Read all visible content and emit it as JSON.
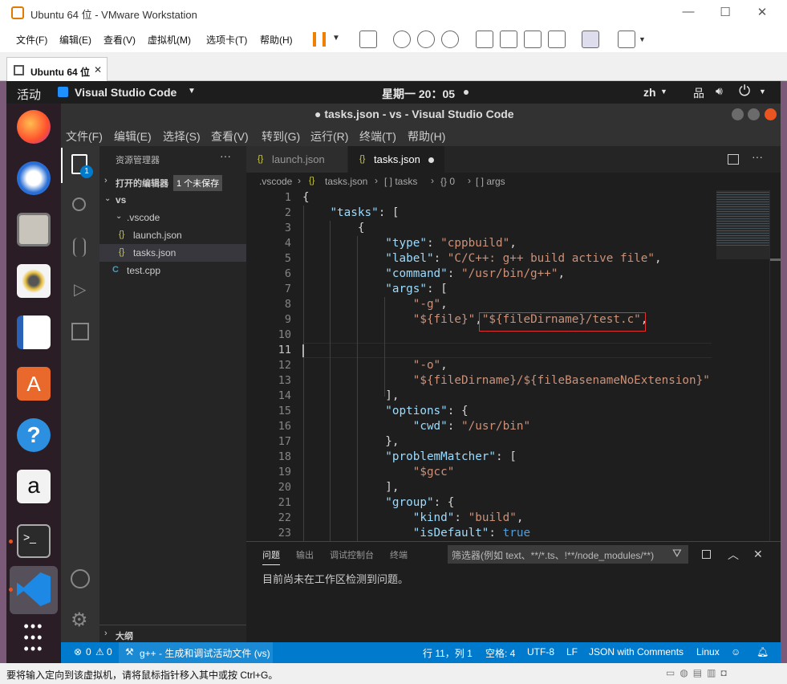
{
  "vmware": {
    "window_title": "Ubuntu 64 位 - VMware Workstation",
    "menus": [
      "文件(F)",
      "编辑(E)",
      "查看(V)",
      "虚拟机(M)",
      "选项卡(T)",
      "帮助(H)"
    ],
    "tab_label": "Ubuntu 64 位",
    "status_hint": "要将输入定向到该虚拟机，请将鼠标指针移入其中或按 Ctrl+G。"
  },
  "gnome": {
    "activities": "活动",
    "app_name": "Visual Studio Code",
    "clock": "星期一 20：05",
    "lang": "zh"
  },
  "vscode": {
    "title": "● tasks.json - vs - Visual Studio Code",
    "menus": [
      "文件(F)",
      "编辑(E)",
      "选择(S)",
      "查看(V)",
      "转到(G)",
      "运行(R)",
      "终端(T)",
      "帮助(H)"
    ],
    "explorer": {
      "header": "资源管理器",
      "open_editors": "打开的编辑器",
      "unsaved_badge": "1 个未保存",
      "folder": "vs",
      "subfolder": ".vscode",
      "files": [
        "launch.json",
        "tasks.json"
      ],
      "root_file": "test.cpp",
      "outline": "大纲"
    },
    "tabs": [
      "launch.json",
      "tasks.json"
    ],
    "breadcrumb": [
      ".vscode",
      "tasks.json",
      "[ ] tasks",
      "{} 0",
      "[ ] args"
    ],
    "source_control_badge": "1",
    "code_lines": [
      [
        {
          "t": "{",
          "c": ""
        }
      ],
      [
        {
          "t": "    ",
          "c": ""
        },
        {
          "t": "\"tasks\"",
          "c": "k"
        },
        {
          "t": ": [",
          "c": ""
        }
      ],
      [
        {
          "t": "        {",
          "c": ""
        }
      ],
      [
        {
          "t": "            ",
          "c": ""
        },
        {
          "t": "\"type\"",
          "c": "k"
        },
        {
          "t": ": ",
          "c": ""
        },
        {
          "t": "\"cppbuild\"",
          "c": "s"
        },
        {
          "t": ",",
          "c": ""
        }
      ],
      [
        {
          "t": "            ",
          "c": ""
        },
        {
          "t": "\"label\"",
          "c": "k"
        },
        {
          "t": ": ",
          "c": ""
        },
        {
          "t": "\"C/C++: g++ build active file\"",
          "c": "s"
        },
        {
          "t": ",",
          "c": ""
        }
      ],
      [
        {
          "t": "            ",
          "c": ""
        },
        {
          "t": "\"command\"",
          "c": "k"
        },
        {
          "t": ": ",
          "c": ""
        },
        {
          "t": "\"/usr/bin/g++\"",
          "c": "s"
        },
        {
          "t": ",",
          "c": ""
        }
      ],
      [
        {
          "t": "            ",
          "c": ""
        },
        {
          "t": "\"args\"",
          "c": "k"
        },
        {
          "t": ": [",
          "c": ""
        }
      ],
      [
        {
          "t": "                ",
          "c": ""
        },
        {
          "t": "\"-g\"",
          "c": "s"
        },
        {
          "t": ",",
          "c": ""
        }
      ],
      [
        {
          "t": "                ",
          "c": ""
        },
        {
          "t": "\"${file}\"",
          "c": "s"
        },
        {
          "t": ",",
          "c": ""
        },
        {
          "t": "\"${fileDirname}/test.c\"",
          "c": "s"
        },
        {
          "t": ",",
          "c": ""
        }
      ],
      [
        {
          "t": "",
          "c": ""
        }
      ],
      [
        {
          "t": "",
          "c": ""
        }
      ],
      [
        {
          "t": "                ",
          "c": ""
        },
        {
          "t": "\"-o\"",
          "c": "s"
        },
        {
          "t": ",",
          "c": ""
        }
      ],
      [
        {
          "t": "                ",
          "c": ""
        },
        {
          "t": "\"${fileDirname}/${fileBasenameNoExtension}\"",
          "c": "s"
        }
      ],
      [
        {
          "t": "            ],",
          "c": ""
        }
      ],
      [
        {
          "t": "            ",
          "c": ""
        },
        {
          "t": "\"options\"",
          "c": "k"
        },
        {
          "t": ": {",
          "c": ""
        }
      ],
      [
        {
          "t": "                ",
          "c": ""
        },
        {
          "t": "\"cwd\"",
          "c": "k"
        },
        {
          "t": ": ",
          "c": ""
        },
        {
          "t": "\"/usr/bin\"",
          "c": "s"
        }
      ],
      [
        {
          "t": "            },",
          "c": ""
        }
      ],
      [
        {
          "t": "            ",
          "c": ""
        },
        {
          "t": "\"problemMatcher\"",
          "c": "k"
        },
        {
          "t": ": [",
          "c": ""
        }
      ],
      [
        {
          "t": "                ",
          "c": ""
        },
        {
          "t": "\"$gcc\"",
          "c": "s"
        }
      ],
      [
        {
          "t": "            ],",
          "c": ""
        }
      ],
      [
        {
          "t": "            ",
          "c": ""
        },
        {
          "t": "\"group\"",
          "c": "k"
        },
        {
          "t": ": {",
          "c": ""
        }
      ],
      [
        {
          "t": "                ",
          "c": ""
        },
        {
          "t": "\"kind\"",
          "c": "k"
        },
        {
          "t": ": ",
          "c": ""
        },
        {
          "t": "\"build\"",
          "c": "s"
        },
        {
          "t": ",",
          "c": ""
        }
      ],
      [
        {
          "t": "                ",
          "c": ""
        },
        {
          "t": "\"isDefault\"",
          "c": "k"
        },
        {
          "t": ": ",
          "c": ""
        },
        {
          "t": "true",
          "c": "b"
        }
      ]
    ],
    "panel": {
      "tabs": [
        "问题",
        "输出",
        "调试控制台",
        "终端"
      ],
      "filter_placeholder": "筛选器(例如 text、**/*.ts、!**/node_modules/**)",
      "message": "目前尚未在工作区检测到问题。"
    },
    "status": {
      "errors": "0",
      "warnings": "0",
      "task": "g++ - 生成和调试活动文件 (vs)",
      "position": "行 11，列 1",
      "indent": "空格: 4",
      "encoding": "UTF-8",
      "eol": "LF",
      "language": "JSON with Comments",
      "os": "Linux"
    }
  }
}
